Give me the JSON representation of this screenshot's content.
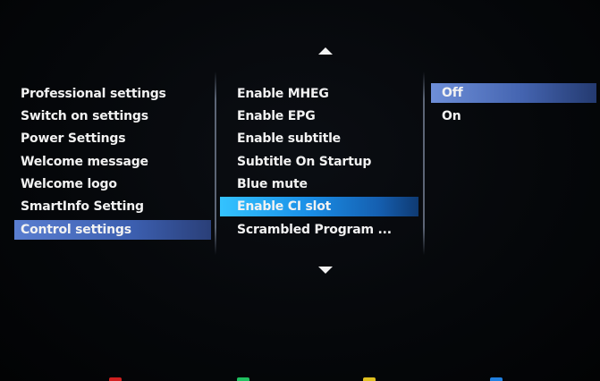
{
  "left_menu": {
    "items": [
      {
        "label": "Professional settings"
      },
      {
        "label": "Switch on settings"
      },
      {
        "label": "Power Settings"
      },
      {
        "label": "Welcome message"
      },
      {
        "label": "Welcome logo"
      },
      {
        "label": "SmartInfo Setting"
      },
      {
        "label": "Control settings",
        "selected": true
      }
    ]
  },
  "middle_menu": {
    "scroll_up_icon": "triangle-up",
    "scroll_down_icon": "triangle-down",
    "items": [
      {
        "label": "Enable MHEG"
      },
      {
        "label": "Enable EPG"
      },
      {
        "label": "Enable subtitle"
      },
      {
        "label": "Subtitle On Startup"
      },
      {
        "label": "Blue mute"
      },
      {
        "label": "Enable CI slot",
        "selected": true
      },
      {
        "label": "Scrambled Program ..."
      }
    ]
  },
  "right_menu": {
    "items": [
      {
        "label": "Off",
        "selected": true
      },
      {
        "label": "On"
      }
    ]
  },
  "colors": {
    "background": "#05070a",
    "text": "#f2f2f2",
    "highlight_blue": "#3c5fb0",
    "highlight_cyan": "#1a8ee6",
    "key_red": "#d02020",
    "key_green": "#20c060",
    "key_yellow": "#e0c020",
    "key_blue": "#2080e0"
  }
}
